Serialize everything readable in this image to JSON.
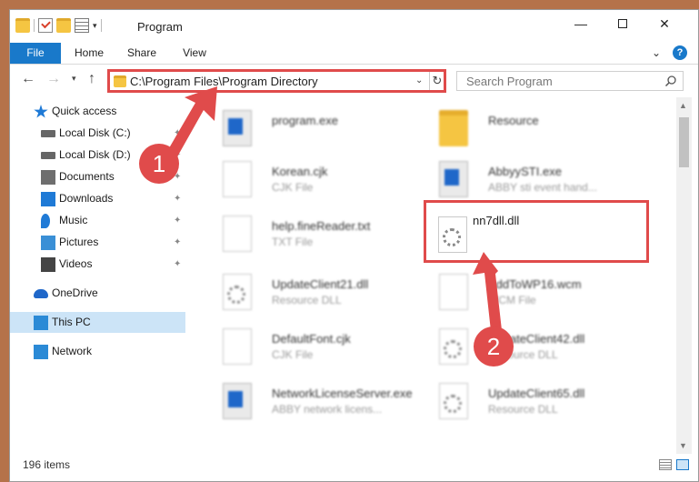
{
  "window": {
    "title": "Program",
    "controls": {
      "minimize": "—",
      "maximize": "",
      "close": "✕"
    }
  },
  "ribbon": {
    "tabs": [
      "File",
      "Home",
      "Share",
      "View"
    ],
    "expand_glyph": "⌄",
    "help_glyph": "?"
  },
  "navigation": {
    "back_glyph": "←",
    "forward_glyph": "→",
    "recent_glyph": "▾",
    "up_glyph": "↑",
    "address": "C:\\Program Files\\Program Directory",
    "address_dropdown_glyph": "⌄",
    "refresh_glyph": "↻",
    "search_placeholder": "Search Program"
  },
  "sidebar": {
    "items": [
      {
        "label": "Quick access",
        "icon": "star-icon",
        "pinned": false
      },
      {
        "label": "Local Disk (C:)",
        "icon": "drive-icon",
        "pinned": true
      },
      {
        "label": "Local Disk (D:)",
        "icon": "drive-icon",
        "pinned": true
      },
      {
        "label": "Documents",
        "icon": "documents-icon",
        "pinned": true
      },
      {
        "label": "Downloads",
        "icon": "download-icon",
        "pinned": true
      },
      {
        "label": "Music",
        "icon": "music-icon",
        "pinned": true
      },
      {
        "label": "Pictures",
        "icon": "pictures-icon",
        "pinned": true
      },
      {
        "label": "Videos",
        "icon": "videos-icon",
        "pinned": true
      },
      {
        "label": "OneDrive",
        "icon": "cloud-icon",
        "pinned": false
      },
      {
        "label": "This PC",
        "icon": "computer-icon",
        "pinned": false,
        "selected": true
      },
      {
        "label": "Network",
        "icon": "network-icon",
        "pinned": false
      }
    ],
    "pin_glyph": "✦"
  },
  "files": [
    {
      "name": "program.exe",
      "type": "",
      "icon": "exe-icon"
    },
    {
      "name": "Resource",
      "type": "",
      "icon": "folder-icon"
    },
    {
      "name": "Korean.cjk",
      "type": "CJK File",
      "icon": "page-icon"
    },
    {
      "name": "AbbyySTI.exe",
      "type": "ABBY sti event hand...",
      "icon": "exe-icon"
    },
    {
      "name": "help.fineReader.txt",
      "type": "TXT File",
      "icon": "page-icon"
    },
    {
      "name": "nn7dll.dll",
      "type": "",
      "icon": "gear-file-icon",
      "highlighted": true
    },
    {
      "name": "UpdateClient21.dll",
      "type": "Resource DLL",
      "icon": "gear-file-icon"
    },
    {
      "name": "AddToWP16.wcm",
      "type": "WCM File",
      "icon": "page-icon"
    },
    {
      "name": "DefaultFont.cjk",
      "type": "CJK File",
      "icon": "page-icon"
    },
    {
      "name": "UpdateClient42.dll",
      "type": "Resource DLL",
      "icon": "gear-file-icon"
    },
    {
      "name": "NetworkLicenseServer.exe",
      "type": "ABBY network licens...",
      "icon": "exe-icon"
    },
    {
      "name": "UpdateClient65.dll",
      "type": "Resource DLL",
      "icon": "gear-file-icon"
    }
  ],
  "status": {
    "item_count": "196 items"
  },
  "annotations": {
    "step1": "1",
    "step2": "2",
    "accent": "#e04b4b"
  }
}
